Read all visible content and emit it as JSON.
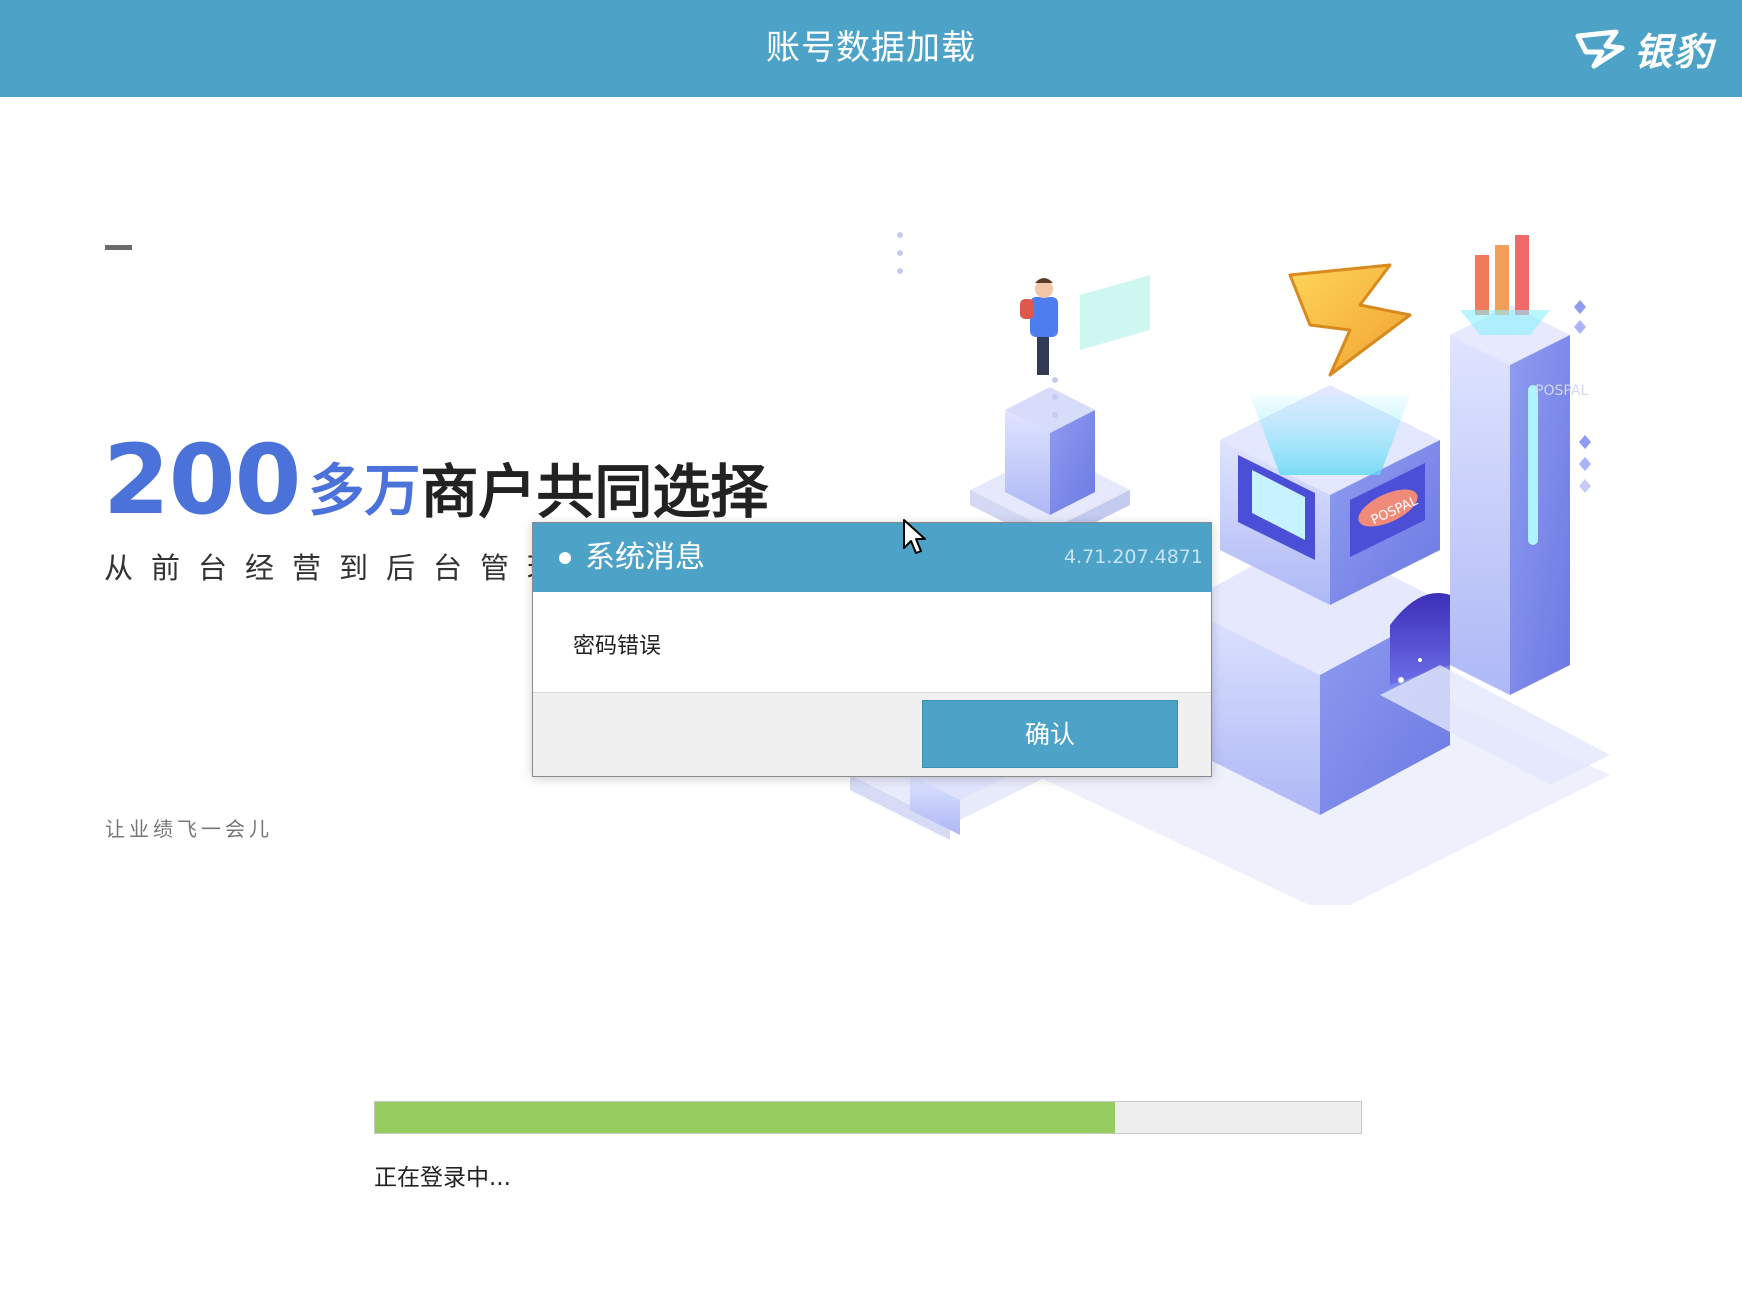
{
  "window": {
    "title": "账号数据加载",
    "brand_name": "银豹",
    "brand_icon": "pospal-logo-icon"
  },
  "hero": {
    "headline_number": "200",
    "headline_unit": "多万",
    "headline_text": "商户共同选择",
    "subheadline": "从前台经营到后台管理",
    "slogan": "让业绩飞一会儿"
  },
  "illustration": {
    "sign_text": "POSPAL",
    "wall_text": "POSPAL"
  },
  "dialog": {
    "title": "系统消息",
    "version": "4.71.207.4871",
    "message": "密码错误",
    "confirm_label": "确认"
  },
  "progress": {
    "value": 0.75,
    "status": "正在登录中..."
  },
  "colors": {
    "titlebar": "#4ca3c7",
    "accent_blue": "#4a72d9",
    "progress_fill": "#96cc60",
    "progress_track": "#eeeeee"
  }
}
